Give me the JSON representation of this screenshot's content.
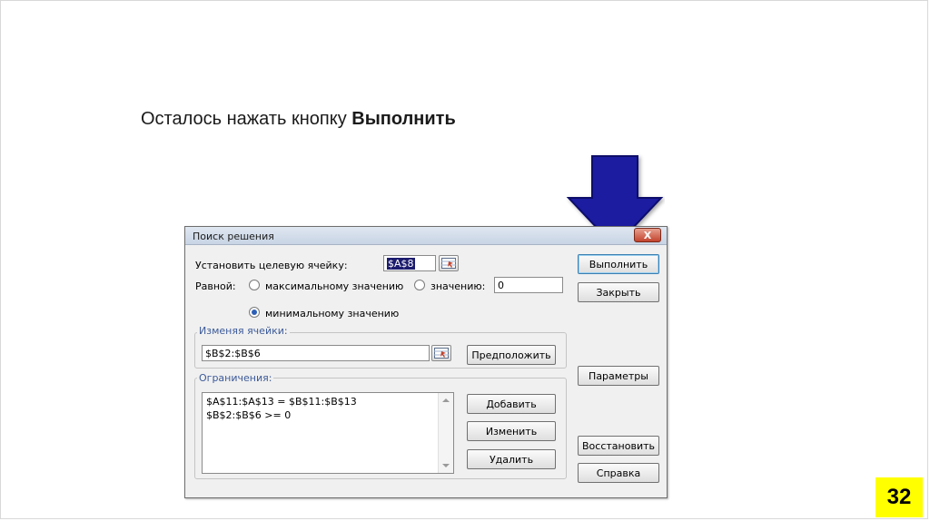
{
  "slide": {
    "caption_prefix": "Осталось нажать кнопку ",
    "caption_bold": "Выполнить",
    "page_number": "32",
    "arrow_color": "#1a1aa0",
    "page_badge_color": "#ffff00"
  },
  "dialog": {
    "title": "Поиск решения",
    "close_label": "X",
    "target_cell_label": "Установить целевую ячейку:",
    "target_cell_value": "$A$8",
    "equal_to_label": "Равной:",
    "radio_max_label": "максимальному значению",
    "radio_value_label": "значению:",
    "value_field": "0",
    "radio_min_label": "минимальному значению",
    "selected_radio": "min",
    "changing_cells_group": "Изменяя ячейки:",
    "changing_cells_value": "$B$2:$B$6",
    "constraints_group": "Ограничения:",
    "constraints": [
      "$A$11:$A$13 = $B$11:$B$13",
      "$B$2:$B$6 >= 0"
    ],
    "buttons": {
      "run": "Выполнить",
      "close": "Закрыть",
      "guess": "Предположить",
      "options": "Параметры",
      "add": "Добавить",
      "change": "Изменить",
      "delete": "Удалить",
      "reset": "Восстановить",
      "help": "Справка"
    }
  }
}
